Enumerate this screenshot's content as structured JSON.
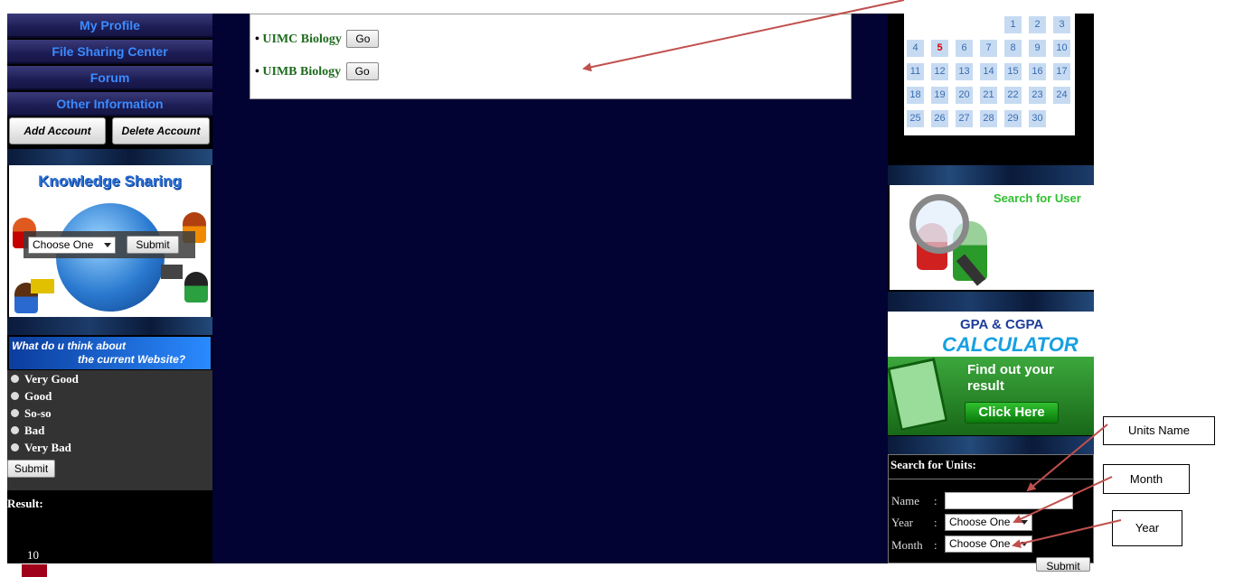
{
  "nav": {
    "items": [
      {
        "label": "My Profile"
      },
      {
        "label": "File Sharing Center"
      },
      {
        "label": "Forum"
      },
      {
        "label": "Other Information"
      }
    ],
    "add_account": "Add Account",
    "delete_account": "Delete Account"
  },
  "knowledge": {
    "title": "Knowledge Sharing",
    "select_value": "Choose One",
    "submit": "Submit"
  },
  "poll": {
    "question_line1": "What do u think about",
    "question_line2": "the current Website?",
    "options": [
      "Very Good",
      "Good",
      "So-so",
      "Bad",
      "Very Bad"
    ],
    "submit": "Submit",
    "result_label": "Result:",
    "result_value": "10"
  },
  "units": [
    {
      "name": "UIMC Biology",
      "button": "Go"
    },
    {
      "name": "UIMB Biology",
      "button": "Go"
    }
  ],
  "calendar": {
    "days": [
      "1",
      "2",
      "3",
      "4",
      "5",
      "6",
      "7",
      "8",
      "9",
      "10",
      "11",
      "12",
      "13",
      "14",
      "15",
      "16",
      "17",
      "18",
      "19",
      "20",
      "21",
      "22",
      "23",
      "24",
      "25",
      "26",
      "27",
      "28",
      "29",
      "30"
    ],
    "today": "5",
    "today_color": "#e00000"
  },
  "search_user": {
    "label": "Search for User"
  },
  "gpa": {
    "line1": "GPA & CGPA",
    "line2": "CALCULATOR",
    "line3": "Find out your",
    "line4": "result",
    "button": "Click Here"
  },
  "search_units": {
    "title": "Search for Units:",
    "name_label": "Name",
    "year_label": "Year",
    "month_label": "Month",
    "colon": ":",
    "year_value": "Choose One",
    "month_value": "Choose One",
    "submit": "Submit"
  },
  "annotations": {
    "units_name": "Units Name",
    "month": "Month",
    "year": "Year"
  },
  "colors": {
    "arrow": "#c0504d",
    "main_bg": "#020233",
    "nav_text": "#3b8bff",
    "unit_text": "#1e6b1e"
  }
}
